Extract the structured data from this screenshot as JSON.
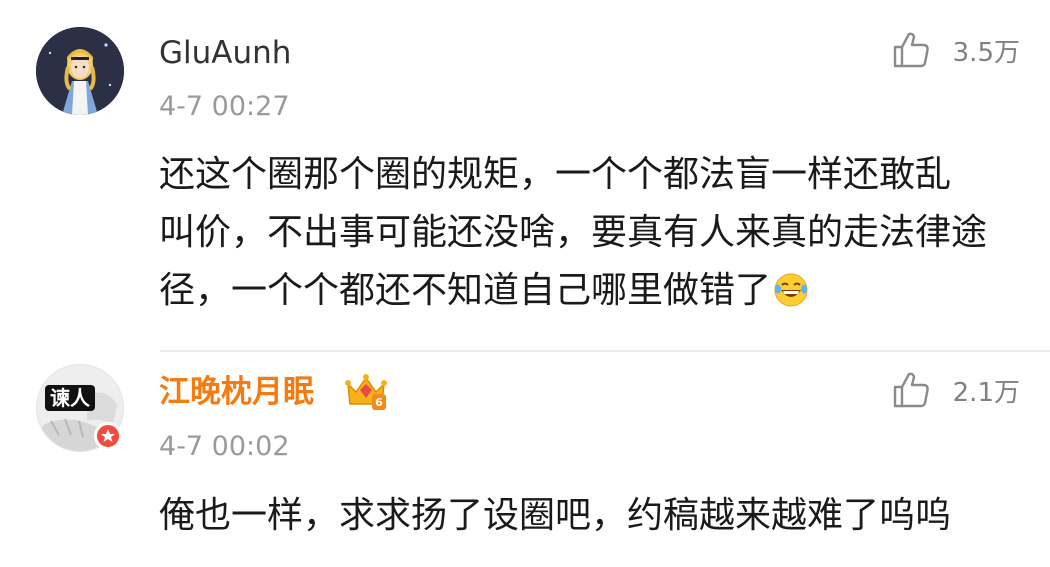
{
  "comments": [
    {
      "username": "GluAunh",
      "timestamp": "4-7 00:27",
      "like_count": "3.5万",
      "avatar_icon": "cartoon-girl-avatar",
      "text_lines": [
        "还这个圈那个圈的规矩，一个个都法盲一样还敢乱",
        "叫价，不出事可能还没啥，要真有人来真的走法律途",
        "径，一个个都还不知道自己哪里做错了"
      ],
      "trailing_emoji": "laughing-crying-emoji"
    },
    {
      "username": "江晚枕月眠",
      "timestamp": "4-7 00:02",
      "like_count": "2.1万",
      "avatar_icon": "sticker-avatar",
      "avatar_badge_text": "谏人",
      "verified_icon": "verified-badge-icon",
      "vip_icon": "vip-crown-badge-icon",
      "text_lines": [
        "俺也一样，求求扬了设圈吧，约稿越来越难了呜呜"
      ]
    }
  ],
  "colors": {
    "username_default": "#333333",
    "username_vip": "#f57a11",
    "timestamp": "#9a9a9a",
    "like_icon": "#8a8a8a",
    "body_text": "#1a1a1a",
    "divider": "#ececec"
  }
}
